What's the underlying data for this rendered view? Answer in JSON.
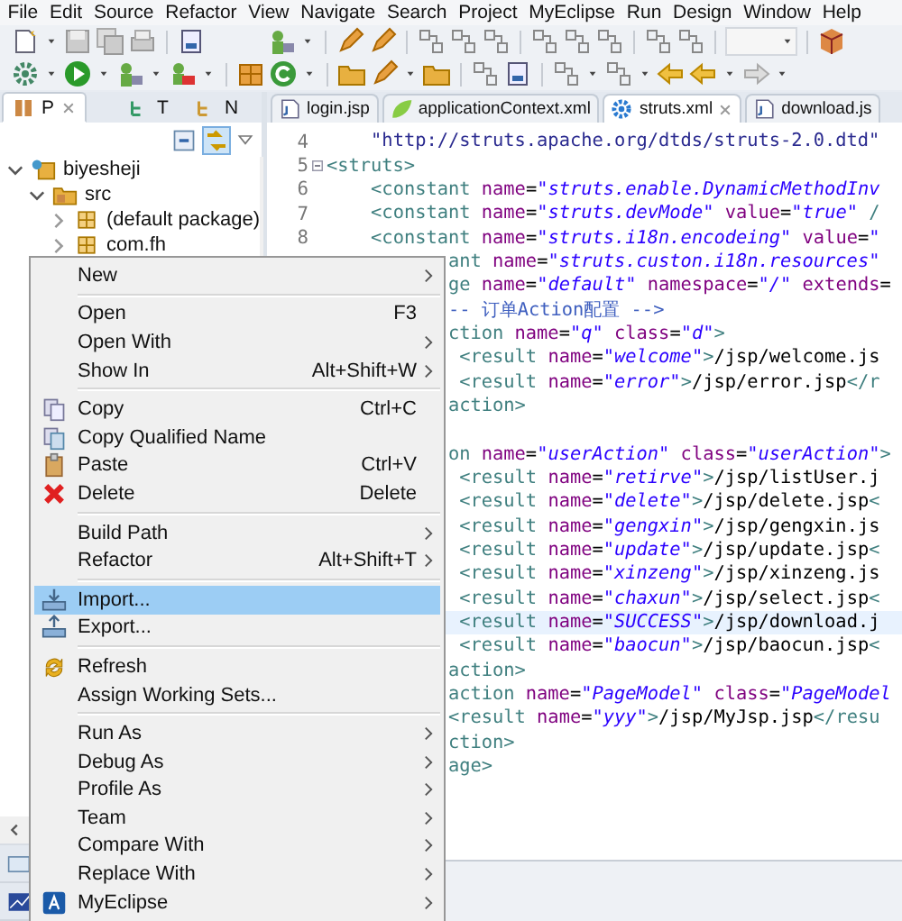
{
  "menu_bar": [
    "File",
    "Edit",
    "Source",
    "Refactor",
    "View",
    "Navigate",
    "Search",
    "Project",
    "MyEclipse",
    "Run",
    "Design",
    "Window",
    "Help"
  ],
  "explorer": {
    "tabs": [
      {
        "label": "P",
        "selected": true
      },
      {
        "label": "T",
        "selected": false
      },
      {
        "label": "N",
        "selected": false
      }
    ],
    "link_with_editor": true,
    "tree": [
      {
        "label": "biyesheji",
        "expanded": true,
        "children": [
          {
            "label": "src",
            "expanded": true,
            "children": [
              {
                "label": "(default package)",
                "expanded": false
              },
              {
                "label": "com.fh",
                "expanded": false
              }
            ]
          }
        ]
      }
    ]
  },
  "editor": {
    "tabs": [
      {
        "label": "login.jsp",
        "kind": "jsp",
        "selected": false
      },
      {
        "label": "applicationContext.xml",
        "kind": "spring",
        "selected": false
      },
      {
        "label": "struts.xml",
        "kind": "struts",
        "selected": true
      },
      {
        "label": "download.js",
        "kind": "jsp",
        "selected": false
      }
    ],
    "lines": [
      {
        "number": "4",
        "current": false,
        "tokens": [
          {
            "kind": "string",
            "text": "    \"http://struts.apache.org/dtds/struts-2.0.dtd\""
          }
        ]
      },
      {
        "number": "5",
        "current": false,
        "fold": true,
        "tokens": [
          {
            "kind": "tag",
            "text": "<struts>"
          }
        ]
      },
      {
        "number": "6",
        "current": false,
        "tokens": [
          {
            "kind": "tag",
            "text": "    <constant "
          },
          {
            "kind": "attr",
            "text": "name"
          },
          {
            "kind": "plain",
            "text": "="
          },
          {
            "kind": "value",
            "text": "\"struts.enable.DynamicMethodInv"
          }
        ]
      },
      {
        "number": "7",
        "current": false,
        "tokens": [
          {
            "kind": "tag",
            "text": "    <constant "
          },
          {
            "kind": "attr",
            "text": "name"
          },
          {
            "kind": "plain",
            "text": "="
          },
          {
            "kind": "value",
            "text": "\"struts.devMode\""
          },
          {
            "kind": "attr",
            "text": " value"
          },
          {
            "kind": "plain",
            "text": "="
          },
          {
            "kind": "value",
            "text": "\"true\""
          },
          {
            "kind": "tag",
            "text": " /"
          }
        ]
      },
      {
        "number": "8",
        "current": false,
        "tokens": [
          {
            "kind": "tag",
            "text": "    <constant "
          },
          {
            "kind": "attr",
            "text": "name"
          },
          {
            "kind": "plain",
            "text": "="
          },
          {
            "kind": "value",
            "text": "\"struts.i18n.encodeing\""
          },
          {
            "kind": "attr",
            "text": " value"
          },
          {
            "kind": "plain",
            "text": "="
          },
          {
            "kind": "value",
            "text": "\""
          }
        ]
      },
      {
        "current": false,
        "tokens": [
          {
            "kind": "tag",
            "text": "           ant "
          },
          {
            "kind": "attr",
            "text": "name"
          },
          {
            "kind": "plain",
            "text": "="
          },
          {
            "kind": "value",
            "text": "\"struts.custon.i18n.resources\""
          }
        ]
      },
      {
        "current": false,
        "tokens": [
          {
            "kind": "tag",
            "text": "           ge "
          },
          {
            "kind": "attr",
            "text": "name"
          },
          {
            "kind": "plain",
            "text": "="
          },
          {
            "kind": "value",
            "text": "\"default\""
          },
          {
            "kind": "attr",
            "text": " namespace"
          },
          {
            "kind": "plain",
            "text": "="
          },
          {
            "kind": "value",
            "text": "\"/\""
          },
          {
            "kind": "attr",
            "text": " extends"
          },
          {
            "kind": "plain",
            "text": "="
          }
        ]
      },
      {
        "current": false,
        "tokens": [
          {
            "kind": "comment",
            "text": "           -- 订单Action配置 -->"
          }
        ]
      },
      {
        "current": false,
        "tokens": [
          {
            "kind": "tag",
            "text": "           ction "
          },
          {
            "kind": "attr",
            "text": "name"
          },
          {
            "kind": "plain",
            "text": "="
          },
          {
            "kind": "value",
            "text": "\"q\""
          },
          {
            "kind": "attr",
            "text": " class"
          },
          {
            "kind": "plain",
            "text": "="
          },
          {
            "kind": "value",
            "text": "\"d\""
          },
          {
            "kind": "tag",
            "text": ">"
          }
        ]
      },
      {
        "current": false,
        "tokens": [
          {
            "kind": "tag",
            "text": "            <result "
          },
          {
            "kind": "attr",
            "text": "name"
          },
          {
            "kind": "plain",
            "text": "="
          },
          {
            "kind": "value",
            "text": "\"welcome\""
          },
          {
            "kind": "tag",
            "text": ">"
          },
          {
            "kind": "plain",
            "text": "/jsp/welcome.js"
          }
        ]
      },
      {
        "current": false,
        "tokens": [
          {
            "kind": "tag",
            "text": "            <result "
          },
          {
            "kind": "attr",
            "text": "name"
          },
          {
            "kind": "plain",
            "text": "="
          },
          {
            "kind": "value",
            "text": "\"error\""
          },
          {
            "kind": "tag",
            "text": ">"
          },
          {
            "kind": "plain",
            "text": "/jsp/error.jsp"
          },
          {
            "kind": "tag",
            "text": "</r"
          }
        ]
      },
      {
        "current": false,
        "tokens": [
          {
            "kind": "tag",
            "text": "           action>"
          }
        ]
      },
      {
        "current": false
      },
      {
        "current": false,
        "tokens": [
          {
            "kind": "tag",
            "text": "           on "
          },
          {
            "kind": "attr",
            "text": "name"
          },
          {
            "kind": "plain",
            "text": "="
          },
          {
            "kind": "value",
            "text": "\"userAction\""
          },
          {
            "kind": "attr",
            "text": " class"
          },
          {
            "kind": "plain",
            "text": "="
          },
          {
            "kind": "value",
            "text": "\"userAction\""
          },
          {
            "kind": "tag",
            "text": ">"
          }
        ]
      },
      {
        "current": false,
        "tokens": [
          {
            "kind": "tag",
            "text": "            <result "
          },
          {
            "kind": "attr",
            "text": "name"
          },
          {
            "kind": "plain",
            "text": "="
          },
          {
            "kind": "value",
            "text": "\"retirve\""
          },
          {
            "kind": "tag",
            "text": ">"
          },
          {
            "kind": "plain",
            "text": "/jsp/listUser.j"
          }
        ]
      },
      {
        "current": false,
        "tokens": [
          {
            "kind": "tag",
            "text": "            <result "
          },
          {
            "kind": "attr",
            "text": "name"
          },
          {
            "kind": "plain",
            "text": "="
          },
          {
            "kind": "value",
            "text": "\"delete\""
          },
          {
            "kind": "tag",
            "text": ">"
          },
          {
            "kind": "plain",
            "text": "/jsp/delete.jsp"
          },
          {
            "kind": "tag",
            "text": "<"
          }
        ]
      },
      {
        "current": false,
        "tokens": [
          {
            "kind": "tag",
            "text": "            <result "
          },
          {
            "kind": "attr",
            "text": "name"
          },
          {
            "kind": "plain",
            "text": "="
          },
          {
            "kind": "value",
            "text": "\"gengxin\""
          },
          {
            "kind": "tag",
            "text": ">"
          },
          {
            "kind": "plain",
            "text": "/jsp/gengxin.js"
          }
        ]
      },
      {
        "current": false,
        "tokens": [
          {
            "kind": "tag",
            "text": "            <result "
          },
          {
            "kind": "attr",
            "text": "name"
          },
          {
            "kind": "plain",
            "text": "="
          },
          {
            "kind": "value",
            "text": "\"update\""
          },
          {
            "kind": "tag",
            "text": ">"
          },
          {
            "kind": "plain",
            "text": "/jsp/update.jsp"
          },
          {
            "kind": "tag",
            "text": "<"
          }
        ]
      },
      {
        "current": false,
        "tokens": [
          {
            "kind": "tag",
            "text": "            <result "
          },
          {
            "kind": "attr",
            "text": "name"
          },
          {
            "kind": "plain",
            "text": "="
          },
          {
            "kind": "value",
            "text": "\"xinzeng\""
          },
          {
            "kind": "tag",
            "text": ">"
          },
          {
            "kind": "plain",
            "text": "/jsp/xinzeng.js"
          }
        ]
      },
      {
        "current": false,
        "tokens": [
          {
            "kind": "tag",
            "text": "            <result "
          },
          {
            "kind": "attr",
            "text": "name"
          },
          {
            "kind": "plain",
            "text": "="
          },
          {
            "kind": "value",
            "text": "\"chaxun\""
          },
          {
            "kind": "tag",
            "text": ">"
          },
          {
            "kind": "plain",
            "text": "/jsp/select.jsp"
          },
          {
            "kind": "tag",
            "text": "<"
          }
        ]
      },
      {
        "current": true,
        "tokens": [
          {
            "kind": "tag",
            "text": "            <result "
          },
          {
            "kind": "attr",
            "text": "name"
          },
          {
            "kind": "plain",
            "text": "="
          },
          {
            "kind": "value",
            "text": "\"SUCCESS\""
          },
          {
            "kind": "tag",
            "text": ">"
          },
          {
            "kind": "plain",
            "text": "/jsp/download.j"
          }
        ]
      },
      {
        "current": false,
        "tokens": [
          {
            "kind": "tag",
            "text": "            <result "
          },
          {
            "kind": "attr",
            "text": "name"
          },
          {
            "kind": "plain",
            "text": "="
          },
          {
            "kind": "value",
            "text": "\"baocun\""
          },
          {
            "kind": "tag",
            "text": ">"
          },
          {
            "kind": "plain",
            "text": "/jsp/baocun.jsp"
          },
          {
            "kind": "tag",
            "text": "<"
          }
        ]
      },
      {
        "current": false,
        "tokens": [
          {
            "kind": "tag",
            "text": "           action>"
          }
        ]
      },
      {
        "current": false,
        "tokens": [
          {
            "kind": "tag",
            "text": "           action "
          },
          {
            "kind": "attr",
            "text": "name"
          },
          {
            "kind": "plain",
            "text": "="
          },
          {
            "kind": "value",
            "text": "\"PageModel\""
          },
          {
            "kind": "attr",
            "text": " class"
          },
          {
            "kind": "plain",
            "text": "="
          },
          {
            "kind": "value",
            "text": "\"PageModel"
          }
        ]
      },
      {
        "current": false,
        "tokens": [
          {
            "kind": "tag",
            "text": "           <result "
          },
          {
            "kind": "attr",
            "text": "name"
          },
          {
            "kind": "plain",
            "text": "="
          },
          {
            "kind": "value",
            "text": "\"yyy\""
          },
          {
            "kind": "tag",
            "text": ">"
          },
          {
            "kind": "plain",
            "text": "/jsp/MyJsp.jsp"
          },
          {
            "kind": "tag",
            "text": "</resu"
          }
        ]
      },
      {
        "current": false,
        "tokens": [
          {
            "kind": "tag",
            "text": "           ction>"
          }
        ]
      },
      {
        "current": false,
        "tokens": [
          {
            "kind": "tag",
            "text": "           age>"
          }
        ]
      }
    ]
  },
  "context_menu": [
    {
      "kind": "item",
      "label": "New",
      "submenu": true,
      "selected": false
    },
    {
      "kind": "separator"
    },
    {
      "kind": "item",
      "label": "Open",
      "shortcut": "F3",
      "submenu": false,
      "selected": false
    },
    {
      "kind": "item",
      "label": "Open With",
      "submenu": true,
      "selected": false
    },
    {
      "kind": "item",
      "label": "Show In",
      "shortcut": "Alt+Shift+W",
      "submenu": true,
      "selected": false
    },
    {
      "kind": "separator"
    },
    {
      "kind": "item",
      "label": "Copy",
      "shortcut": "Ctrl+C",
      "submenu": false,
      "selected": false
    },
    {
      "kind": "item",
      "label": "Copy Qualified Name",
      "submenu": false,
      "selected": false
    },
    {
      "kind": "item",
      "label": "Paste",
      "shortcut": "Ctrl+V",
      "submenu": false,
      "selected": false
    },
    {
      "kind": "item",
      "label": "Delete",
      "shortcut": "Delete",
      "submenu": false,
      "selected": false
    },
    {
      "kind": "separator"
    },
    {
      "kind": "item",
      "label": "Build Path",
      "submenu": true,
      "selected": false
    },
    {
      "kind": "item",
      "label": "Refactor",
      "shortcut": "Alt+Shift+T",
      "submenu": true,
      "selected": false
    },
    {
      "kind": "separator"
    },
    {
      "kind": "item",
      "label": "Import...",
      "submenu": false,
      "selected": true
    },
    {
      "kind": "item",
      "label": "Export...",
      "submenu": false,
      "selected": false
    },
    {
      "kind": "separator"
    },
    {
      "kind": "item",
      "label": "Refresh",
      "submenu": false,
      "selected": false
    },
    {
      "kind": "item",
      "label": "Assign Working Sets...",
      "submenu": false,
      "selected": false
    },
    {
      "kind": "separator"
    },
    {
      "kind": "item",
      "label": "Run As",
      "submenu": true,
      "selected": false
    },
    {
      "kind": "item",
      "label": "Debug As",
      "submenu": true,
      "selected": false
    },
    {
      "kind": "item",
      "label": "Profile As",
      "submenu": true,
      "selected": false
    },
    {
      "kind": "item",
      "label": "Team",
      "submenu": true,
      "selected": false
    },
    {
      "kind": "item",
      "label": "Compare With",
      "submenu": true,
      "selected": false
    },
    {
      "kind": "item",
      "label": "Replace With",
      "submenu": true,
      "selected": false
    },
    {
      "kind": "item",
      "label": "MyEclipse",
      "submenu": true,
      "selected": false
    }
  ]
}
